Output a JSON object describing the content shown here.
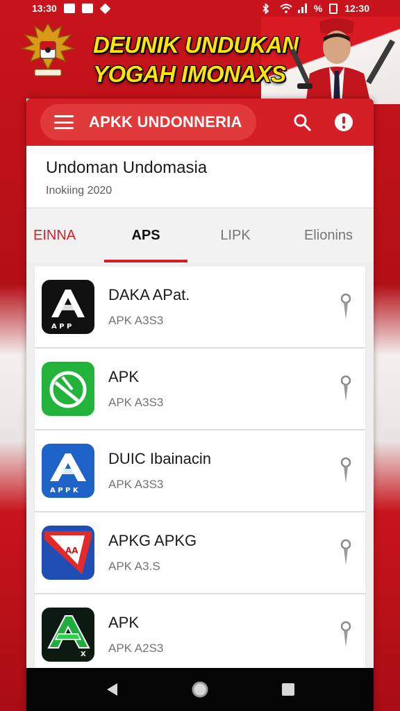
{
  "status_bar": {
    "time_left": "13:30",
    "battery_text": "%",
    "time_right": "12:30"
  },
  "banner": {
    "line1": "DEUNIK UNDUKAN",
    "line2": "YOGAH IMONAXS"
  },
  "toolbar": {
    "title": "APKK UNDONNERIA"
  },
  "header": {
    "title": "Undoman Undomasia",
    "subtitle": "Inokiing 2020"
  },
  "tabs": [
    {
      "label": "EINNA"
    },
    {
      "label": "APS"
    },
    {
      "label": "LIPK"
    },
    {
      "label": "Elionins"
    }
  ],
  "apps": [
    {
      "name": "DAKA APat.",
      "meta": "APK A3S3",
      "icon": "apk-a-black-icon"
    },
    {
      "name": "APK",
      "meta": "APK A3S3",
      "icon": "apk-green-circle-icon"
    },
    {
      "name": "DUIC Ibainacin",
      "meta": "APK A3S3",
      "icon": "apk-a-blue-icon"
    },
    {
      "name": "APKG APKG",
      "meta": "APK A3.S",
      "icon": "apk-red-blue-icon"
    },
    {
      "name": "APK",
      "meta": "APK A2S3",
      "icon": "apk-green-a-icon"
    }
  ],
  "colors": {
    "primary_red": "#d51f26",
    "banner_yellow": "#ffe600"
  }
}
